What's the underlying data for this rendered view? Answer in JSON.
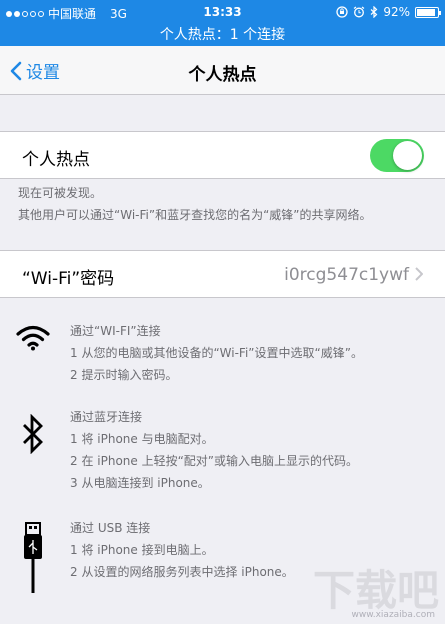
{
  "status_bar": {
    "carrier": "中国联通",
    "network": "3G",
    "time": "13:33",
    "battery": "92%",
    "battery_level": 0.92
  },
  "hotspot_banner": "个人热点：1 个连接",
  "nav": {
    "back_label": "设置",
    "title": "个人热点"
  },
  "hotspot_toggle": {
    "label": "个人热点",
    "on": true
  },
  "discoverable_note": [
    "现在可被发现。",
    "其他用户可以通过“Wi-Fi”和蓝牙查找您的名为“威锋”的共享网络。"
  ],
  "wifi_password": {
    "label": "“Wi-Fi”密码",
    "value": "i0rcg547c1ywf"
  },
  "instructions": {
    "wifi": {
      "icon": "wifi-icon",
      "lines": [
        "通过“WI-FI”连接",
        "1 从您的电脑或其他设备的“Wi-Fi”设置中选取“威锋”。",
        "2 提示时输入密码。"
      ]
    },
    "bluetooth": {
      "icon": "bluetooth-icon",
      "lines": [
        "通过蓝牙连接",
        "1 将 iPhone 与电脑配对。",
        "2 在 iPhone 上轻按“配对”或输入电脑上显示的代码。",
        "3 从电脑连接到 iPhone。"
      ]
    },
    "usb": {
      "icon": "usb-cable-icon",
      "lines": [
        "通过 USB 连接",
        "1 将 iPhone 接到电脑上。",
        "2 从设置的网络服务列表中选择 iPhone。"
      ]
    }
  },
  "watermark": {
    "text": "下载吧",
    "url": "www.xiazaiba.com"
  },
  "colors": {
    "accent": "#1e88e5",
    "toggle_on": "#4cd964",
    "background": "#efeff4",
    "secondary_text": "#6d6d72"
  }
}
